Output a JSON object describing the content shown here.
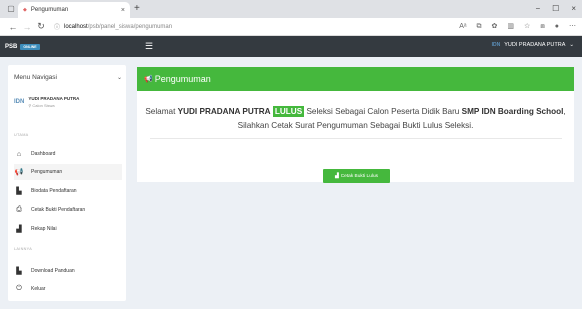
{
  "browser": {
    "tab_title": "Pengumuman",
    "tab_close": "×",
    "new_tab": "+",
    "url_host": "localhost",
    "url_path": "/psb/panel_siswa/pengumuman",
    "window_controls": [
      "−",
      "☐",
      "×"
    ]
  },
  "header": {
    "brand": "PSB",
    "brand_badge": "ONLINE",
    "menu_icon": "☰",
    "user_logo": "IDN",
    "user_name": "YUDI PRADANA PUTRA",
    "user_caret": "⌄"
  },
  "sidebar": {
    "menu_title": "Menu Navigasi",
    "profile_logo": "IDN",
    "profile_name": "YUDI PRADANA PUTRA",
    "profile_role": "Calon Siswa",
    "section_utama": "UTAMA",
    "section_lainnya": "LAINNYA",
    "items": [
      {
        "label": "Dashboard",
        "icon": "home-icon"
      },
      {
        "label": "Pengumuman",
        "icon": "bullhorn-icon"
      },
      {
        "label": "Biodata Pendaftaran",
        "icon": "file-icon"
      },
      {
        "label": "Cetak Bukti Pendaftaran",
        "icon": "print-icon"
      },
      {
        "label": "Rekap Nilai",
        "icon": "bank-icon"
      },
      {
        "label": "Download Panduan",
        "icon": "file-download-icon"
      },
      {
        "label": "Keluar",
        "icon": "power-icon"
      }
    ]
  },
  "main": {
    "panel_title": "Pengumuman",
    "msg_pre": "Selamat ",
    "msg_name": "YUDI PRADANA PUTRA",
    "msg_status": "LULUS",
    "msg_mid": " Seleksi Sebagai Calon Peserta Didik Baru ",
    "msg_school": "SMP IDN Boarding School",
    "msg_end": ",",
    "msg_line2": "Silahkan Cetak Surat Pengumuman Sebagai Bukti Lulus Seleksi.",
    "print_button": "Cetak Bukti Lulus"
  },
  "colors": {
    "accent_green": "#45b83d",
    "header_dark": "#343a40",
    "badge_blue": "#3c8dbc"
  }
}
